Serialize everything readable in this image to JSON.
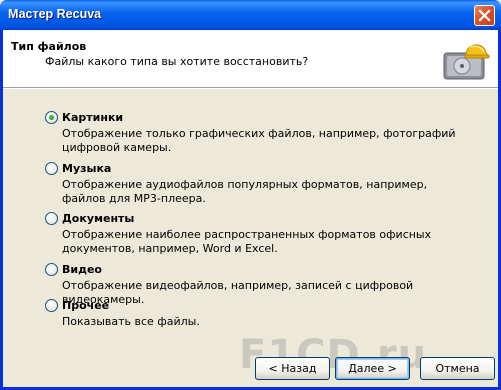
{
  "window": {
    "title": "Мастер Recuva"
  },
  "header": {
    "title": "Тип файлов",
    "subtitle": "Файлы какого типа вы хотите восстановить?",
    "logo_icon": "recuva-hdd-helmet-icon"
  },
  "options": [
    {
      "label": "Картинки",
      "description": "Отображение только графических файлов, например, фотографий цифровой камеры.",
      "selected": true
    },
    {
      "label": "Музыка",
      "description": "Отображение аудиофайлов популярных форматов, например, файлов для MP3-плеера.",
      "selected": false
    },
    {
      "label": "Документы",
      "description": "Отображение наиболее распространенных форматов офисных документов, например, Word и Excel.",
      "selected": false
    },
    {
      "label": "Видео",
      "description": "Отображение видеофайлов, например, записей с цифровой видеокамеры.",
      "selected": false
    },
    {
      "label": "Прочее",
      "description": "Показывать все файлы.",
      "selected": false
    }
  ],
  "buttons": {
    "back": "< Назад",
    "next": "Далее >",
    "cancel": "Отмена"
  },
  "watermark": "F1CD.ru",
  "colors": {
    "titlebar": "#0054e3",
    "radio_selected": "#21a121",
    "background": "#ece9d8"
  }
}
